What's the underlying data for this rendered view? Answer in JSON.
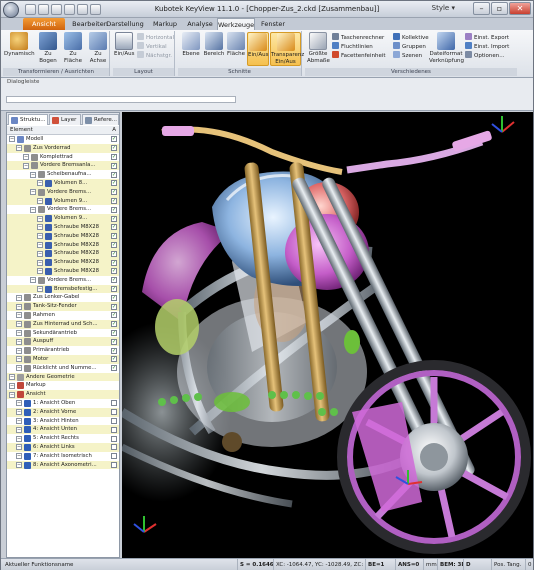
{
  "app": {
    "title": "Kubotek KeyView 11.1.0 - [Chopper-Zus_2.ckd [Zusammenbau]]",
    "style_label": "Style",
    "window_controls": [
      "–",
      "▫",
      "✕",
      "✕"
    ]
  },
  "tabs": [
    "Ansicht",
    "Bearbeiten",
    "Darstellung",
    "Markup",
    "Analyse",
    "Werkzeuge",
    "Fenster"
  ],
  "active_tab": "Werkzeuge",
  "ribbon": {
    "groups": [
      {
        "label": "Transformieren / Ausrichten",
        "buttons": [
          "Dynamisch",
          "Zu Bogen",
          "Zu Fläche",
          "Zu Achse"
        ]
      },
      {
        "label": "Layout",
        "buttons": [
          "Ein/Aus"
        ],
        "small": [
          "Horizontal",
          "Vertikal",
          "Nächstgr."
        ]
      },
      {
        "label": "Schnitte",
        "buttons": [
          "Ebene",
          "Bereich",
          "Fläche",
          "Ein/Aus",
          "Transparenz Ein/Aus"
        ]
      },
      {
        "label": "Verschiedenes",
        "buttons": [
          "Größte Abmaße",
          "Dateiformat Verknüpfung"
        ],
        "small": [
          "Taschenrechner",
          "Fluchtlinien",
          "Facettenfeinheit",
          "Kollektive",
          "Gruppen",
          "Szenen",
          "Einst. Export",
          "Einst. Import",
          "Optionen..."
        ]
      }
    ]
  },
  "dialog": {
    "label": "Dialogleiste",
    "value": ""
  },
  "panel": {
    "tabs": [
      "Struktu...",
      "Layer",
      "Refere..."
    ],
    "header": {
      "element": "Element",
      "a": "A"
    },
    "rows": [
      {
        "text": "Modell",
        "level": 0,
        "hl": false,
        "checked": true,
        "color": "#6a86c4"
      },
      {
        "text": "Zus Vorderrad",
        "level": 1,
        "hl": true,
        "checked": true,
        "color": "#8e8e8e"
      },
      {
        "text": "Komplettrad",
        "level": 2,
        "hl": false,
        "checked": true,
        "color": "#8e8e8e"
      },
      {
        "text": "Vordere Bremsanla...",
        "level": 2,
        "hl": true,
        "checked": true,
        "color": "#8e8e8e"
      },
      {
        "text": "Scheibenaufna...",
        "level": 3,
        "hl": false,
        "checked": true,
        "color": "#8e8e8e"
      },
      {
        "text": "Volumen 8...",
        "level": 4,
        "hl": true,
        "checked": true,
        "color": "#3a5fae"
      },
      {
        "text": "Vordere Brems...",
        "level": 3,
        "hl": true,
        "checked": true,
        "color": "#8e8e8e"
      },
      {
        "text": "Volumen 9...",
        "level": 4,
        "hl": true,
        "checked": true,
        "color": "#3a5fae"
      },
      {
        "text": "Vordere Brems...",
        "level": 3,
        "hl": false,
        "checked": true,
        "color": "#8e8e8e"
      },
      {
        "text": "Volumen 9...",
        "level": 4,
        "hl": true,
        "checked": true,
        "color": "#3a5fae"
      },
      {
        "text": "Schraube M8X28",
        "level": 4,
        "hl": true,
        "checked": true,
        "color": "#3a5fae"
      },
      {
        "text": "Schraube M8X28",
        "level": 4,
        "hl": true,
        "checked": true,
        "color": "#3a5fae"
      },
      {
        "text": "Schraube M8X28",
        "level": 4,
        "hl": true,
        "checked": true,
        "color": "#3a5fae"
      },
      {
        "text": "Schraube M8X28",
        "level": 4,
        "hl": true,
        "checked": true,
        "color": "#3a5fae"
      },
      {
        "text": "Schraube M8X28",
        "level": 4,
        "hl": true,
        "checked": true,
        "color": "#3a5fae"
      },
      {
        "text": "Schraube M8X28",
        "level": 4,
        "hl": true,
        "checked": true,
        "color": "#3a5fae"
      },
      {
        "text": "Vordere Brems...",
        "level": 3,
        "hl": false,
        "checked": true,
        "color": "#8e8e8e"
      },
      {
        "text": "Bremsbefestig...",
        "level": 4,
        "hl": true,
        "checked": true,
        "color": "#3a5fae"
      },
      {
        "text": "Zus Lenker-Gabel",
        "level": 1,
        "hl": false,
        "checked": true,
        "color": "#8e8e8e"
      },
      {
        "text": "Tank-Sitz-Fender",
        "level": 1,
        "hl": true,
        "checked": true,
        "color": "#8e8e8e"
      },
      {
        "text": "Rahmen",
        "level": 1,
        "hl": false,
        "checked": true,
        "color": "#8e8e8e"
      },
      {
        "text": "Zus Hinterrad und Sch...",
        "level": 1,
        "hl": true,
        "checked": true,
        "color": "#8e8e8e"
      },
      {
        "text": "Sekundärantrieb",
        "level": 1,
        "hl": false,
        "checked": true,
        "color": "#8e8e8e"
      },
      {
        "text": "Auspuff",
        "level": 1,
        "hl": true,
        "checked": true,
        "color": "#8e8e8e"
      },
      {
        "text": "Primärantrieb",
        "level": 1,
        "hl": false,
        "checked": true,
        "color": "#8e8e8e"
      },
      {
        "text": "Motor",
        "level": 1,
        "hl": true,
        "checked": true,
        "color": "#8e8e8e"
      },
      {
        "text": "Rücklicht und Numme...",
        "level": 1,
        "hl": false,
        "checked": true,
        "color": "#8e8e8e"
      },
      {
        "text": "Andere Geometrie",
        "level": 0,
        "hl": true,
        "checked": false,
        "color": "#9c9c9c"
      },
      {
        "text": "Markup",
        "level": 0,
        "hl": false,
        "checked": false,
        "color": "#c0463a"
      },
      {
        "text": "Ansicht",
        "level": 0,
        "hl": true,
        "checked": false,
        "color": "#c0463a"
      },
      {
        "text": "1: Ansicht Oben",
        "level": 1,
        "hl": false,
        "checked": false,
        "color": "#2f5fb8"
      },
      {
        "text": "2: Ansicht Vorne",
        "level": 1,
        "hl": true,
        "checked": false,
        "color": "#2f5fb8"
      },
      {
        "text": "3: Ansicht Hinten",
        "level": 1,
        "hl": false,
        "checked": false,
        "color": "#2f5fb8"
      },
      {
        "text": "4: Ansicht Unten",
        "level": 1,
        "hl": true,
        "checked": false,
        "color": "#2f5fb8"
      },
      {
        "text": "5: Ansicht Rechts",
        "level": 1,
        "hl": false,
        "checked": false,
        "color": "#2f5fb8"
      },
      {
        "text": "6: Ansicht Links",
        "level": 1,
        "hl": true,
        "checked": false,
        "color": "#2f5fb8"
      },
      {
        "text": "7: Ansicht Isometrisch",
        "level": 1,
        "hl": false,
        "checked": false,
        "color": "#2f5fb8"
      },
      {
        "text": "8: Ansicht Axonometri...",
        "level": 1,
        "hl": true,
        "checked": false,
        "color": "#2f5fb8"
      }
    ]
  },
  "status": {
    "left": "Aktueller Funktionsname",
    "s": "S = 0.16463",
    "coords": "XC: -1064.47, YC: -1028.49, ZC: 0.0000",
    "be": "BE=1",
    "ans": "ANS=0",
    "mm": "mm",
    "bem": "BEM: 3D",
    "d": "D",
    "pos": "Pos. Tang.",
    "num": "0"
  },
  "colors": {
    "accent": "#e3842a",
    "selection": "#f5f3c8",
    "ribbon_on": "#f5c04e"
  }
}
